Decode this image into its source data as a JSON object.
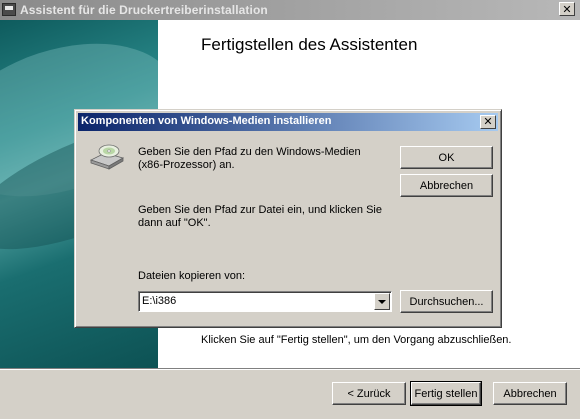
{
  "window": {
    "title": "Assistent für die Druckertreiberinstallation",
    "close_glyph": "✕"
  },
  "wizard": {
    "heading": "Fertigstellen des Assistenten",
    "instruction": "Klicken Sie auf \"Fertig stellen\", um den Vorgang abzuschließen.",
    "buttons": {
      "back": "< Zurück",
      "finish": "Fertig stellen",
      "cancel": "Abbrechen"
    }
  },
  "dialog": {
    "title": "Komponenten von Windows-Medien installieren",
    "close_glyph": "✕",
    "message1": "Geben Sie den Pfad zu den Windows-Medien (x86-Prozessor) an.",
    "message2": "Geben Sie den Pfad zur Datei ein, und klicken Sie dann auf \"OK\".",
    "copy_label": "Dateien kopieren von:",
    "path_value": "E:\\i386",
    "buttons": {
      "ok": "OK",
      "cancel": "Abbrechen",
      "browse": "Durchsuchen..."
    },
    "icon": "cd-drive-icon"
  },
  "colors": {
    "dialog_title_start": "#0a246a",
    "dialog_title_end": "#a6caf0",
    "side_panel": "#0e5b5d",
    "face": "#d4d0c8"
  }
}
